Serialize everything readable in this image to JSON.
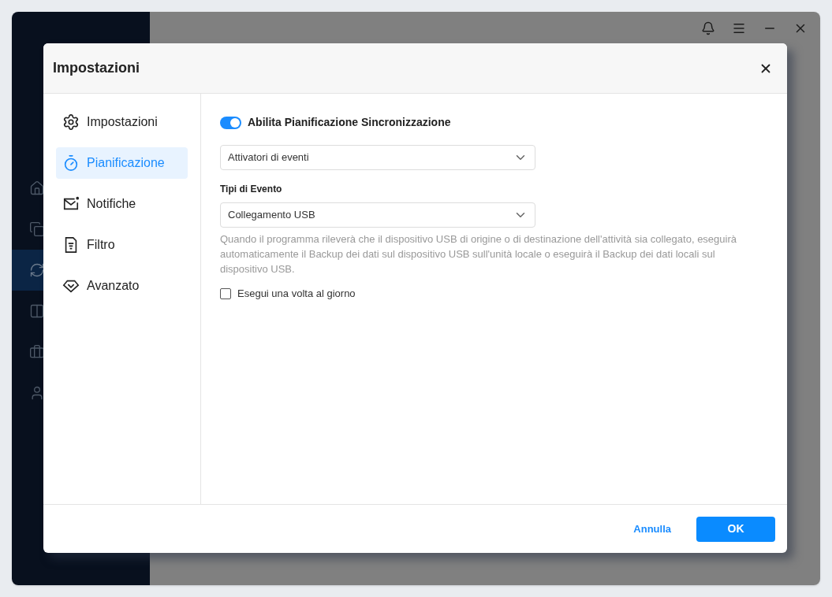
{
  "app_sidebar": {
    "items": [
      {
        "kind": "home",
        "selected": false
      },
      {
        "kind": "copy",
        "selected": false
      },
      {
        "kind": "sync",
        "selected": true
      },
      {
        "kind": "columns",
        "selected": false
      },
      {
        "kind": "briefcase",
        "selected": false
      },
      {
        "kind": "user",
        "selected": false
      }
    ]
  },
  "dialog": {
    "title": "Impostazioni",
    "nav": [
      {
        "kind": "settings",
        "label": "Impostazioni",
        "selected": false
      },
      {
        "kind": "timer",
        "label": "Pianificazione",
        "selected": true
      },
      {
        "kind": "mail",
        "label": "Notifiche",
        "selected": false
      },
      {
        "kind": "filter",
        "label": "Filtro",
        "selected": false
      },
      {
        "kind": "gem",
        "label": "Avanzato",
        "selected": false
      }
    ],
    "toggle": {
      "label": "Abilita Pianificazione Sincronizzazione",
      "on": true
    },
    "trigger_select": {
      "value": "Attivatori di eventi"
    },
    "event_type": {
      "label": "Tipi di Evento",
      "value": "Collegamento USB"
    },
    "description": "Quando il programma rileverà che il dispositivo USB di origine o di destinazione dell'attività sia collegato, eseguirà automaticamente il Backup dei dati sul dispositivo USB sull'unità locale o eseguirà il Backup dei dati locali sul dispositivo USB.",
    "checkbox": {
      "label": "Esegui una volta al giorno",
      "checked": false
    },
    "buttons": {
      "cancel": "Annulla",
      "ok": "OK"
    }
  }
}
